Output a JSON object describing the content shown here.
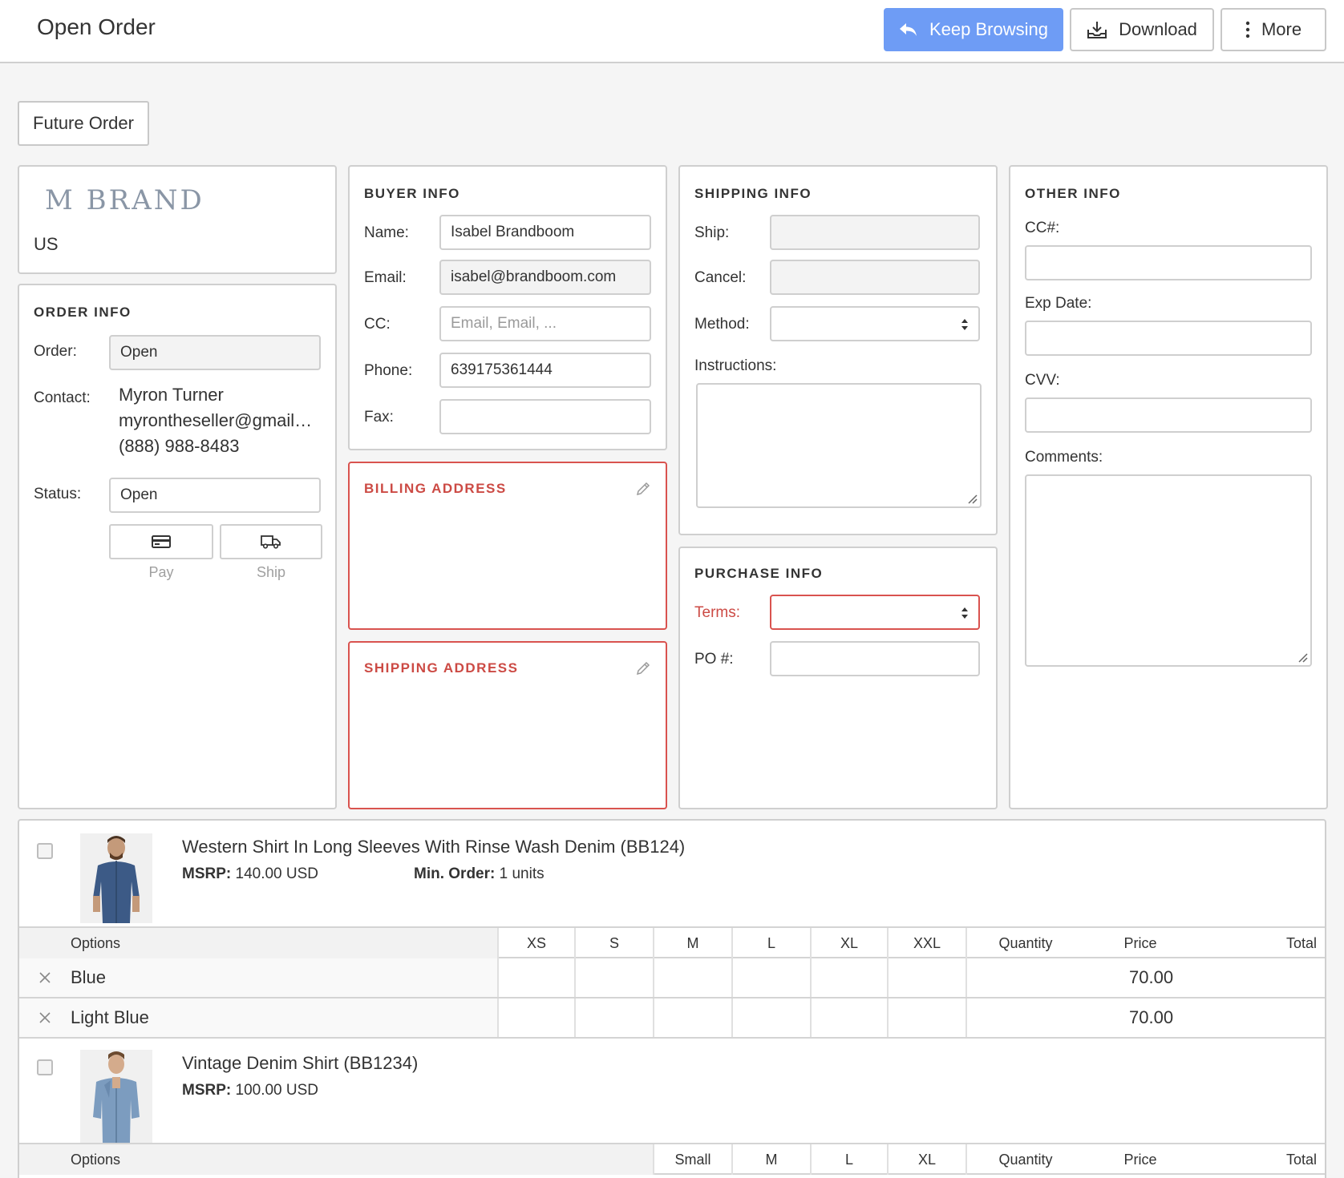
{
  "header": {
    "title": "Open Order",
    "keep_browsing": "Keep Browsing",
    "download": "Download",
    "more": "More"
  },
  "future_order": "Future Order",
  "brand": {
    "logo_text": "M BRAND",
    "country": "US"
  },
  "order_info": {
    "title": "ORDER INFO",
    "order_label": "Order:",
    "order_value": "Open",
    "contact_label": "Contact:",
    "contact_name": "Myron Turner",
    "contact_email": "myrontheseller@gmail…",
    "contact_phone": "(888) 988-8483",
    "status_label": "Status:",
    "status_value": "Open",
    "pay_label": "Pay",
    "ship_label": "Ship"
  },
  "buyer_info": {
    "title": "BUYER INFO",
    "name_label": "Name:",
    "name_value": "Isabel Brandboom",
    "email_label": "Email:",
    "email_value": "isabel@brandboom.com",
    "cc_label": "CC:",
    "cc_placeholder": "Email, Email, ...",
    "phone_label": "Phone:",
    "phone_value": "639175361444",
    "fax_label": "Fax:",
    "fax_value": ""
  },
  "billing_address": {
    "title": "BILLING ADDRESS"
  },
  "shipping_address": {
    "title": "SHIPPING ADDRESS"
  },
  "shipping_info": {
    "title": "SHIPPING INFO",
    "ship_label": "Ship:",
    "cancel_label": "Cancel:",
    "method_label": "Method:",
    "instructions_label": "Instructions:"
  },
  "purchase_info": {
    "title": "PURCHASE INFO",
    "terms_label": "Terms:",
    "po_label": "PO #:"
  },
  "other_info": {
    "title": "OTHER INFO",
    "cc_label": "CC#:",
    "exp_label": "Exp Date:",
    "cvv_label": "CVV:",
    "comments_label": "Comments:"
  },
  "products": [
    {
      "name": "Western Shirt In Long Sleeves With Rinse Wash Denim (BB124)",
      "msrp_label": "MSRP:",
      "msrp_value": "140.00 USD",
      "min_label": "Min. Order:",
      "min_value": "1 units",
      "options_header": "Options",
      "sizes": [
        "XS",
        "S",
        "M",
        "L",
        "XL",
        "XXL"
      ],
      "quantity_header": "Quantity",
      "price_header": "Price",
      "total_header": "Total",
      "rows": [
        {
          "option": "Blue",
          "price": "70.00"
        },
        {
          "option": "Light Blue",
          "price": "70.00"
        }
      ]
    },
    {
      "name": "Vintage Denim Shirt (BB1234)",
      "msrp_label": "MSRP:",
      "msrp_value": "100.00 USD",
      "options_header": "Options",
      "sizes": [
        "Small",
        "M",
        "L",
        "XL"
      ],
      "quantity_header": "Quantity",
      "price_header": "Price",
      "total_header": "Total"
    }
  ],
  "colors": {
    "primary": "#6e9cf5",
    "required": "#cc4a44",
    "border": "#cfcfcf"
  }
}
